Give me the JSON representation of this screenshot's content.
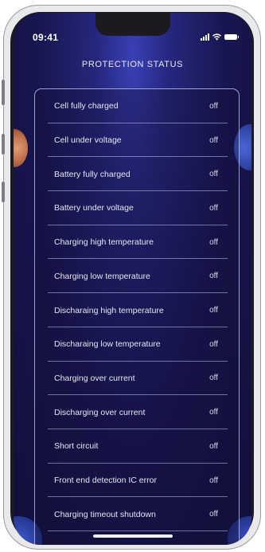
{
  "status_bar": {
    "time": "09:41"
  },
  "header": {
    "title": "PROTECTION STATUS"
  },
  "rows": [
    {
      "label": "Cell fully charged",
      "value": "off"
    },
    {
      "label": "Cell under voltage",
      "value": "off"
    },
    {
      "label": "Battery fully charged",
      "value": "off"
    },
    {
      "label": "Battery under voltage",
      "value": "off"
    },
    {
      "label": "Charging high temperature",
      "value": "off"
    },
    {
      "label": "Charging low temperature",
      "value": "off"
    },
    {
      "label": "Discharaing high temperature",
      "value": "off"
    },
    {
      "label": "Discharaing low temperature",
      "value": "off"
    },
    {
      "label": "Charging over current",
      "value": "off"
    },
    {
      "label": "Discharging over current",
      "value": "off"
    },
    {
      "label": "Short circuit",
      "value": "off"
    },
    {
      "label": "Front end detection IC error",
      "value": "off"
    },
    {
      "label": "Charging timeout shutdown",
      "value": "off"
    }
  ],
  "colors": {
    "background": "#181650",
    "accent": "#3a3fb5",
    "border": "#c8cdff"
  }
}
